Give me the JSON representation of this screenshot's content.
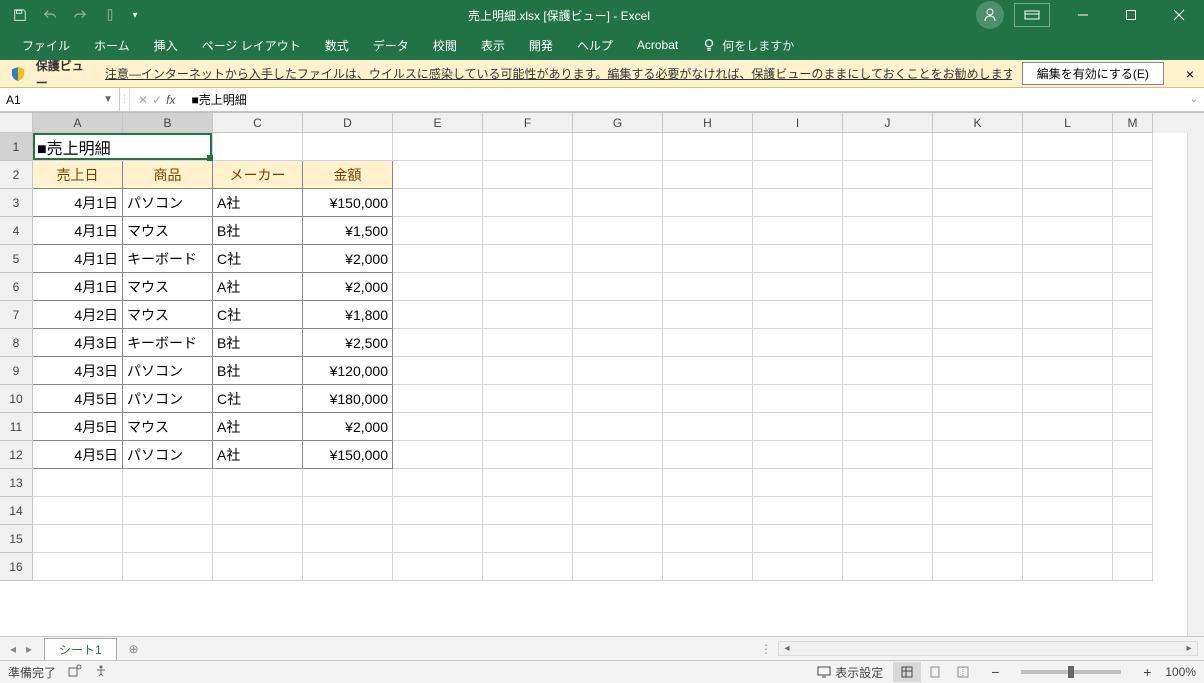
{
  "title": "売上明細.xlsx [保護ビュー] - Excel",
  "ribbon": {
    "tabs": [
      "ファイル",
      "ホーム",
      "挿入",
      "ページ レイアウト",
      "数式",
      "データ",
      "校閲",
      "表示",
      "開発",
      "ヘルプ",
      "Acrobat"
    ],
    "tell_me": "何をしますか"
  },
  "protected_view": {
    "label": "保護ビュー",
    "message": "注意—インターネットから入手したファイルは、ウイルスに感染している可能性があります。編集する必要がなければ、保護ビューのままにしておくことをお勧めします。",
    "button": "編集を有効にする(E)"
  },
  "formula_bar": {
    "name_box": "A1",
    "fx": "fx",
    "content": "■売上明細"
  },
  "columns": [
    "A",
    "B",
    "C",
    "D",
    "E",
    "F",
    "G",
    "H",
    "I",
    "J",
    "K",
    "L",
    "M"
  ],
  "row_numbers": [
    "1",
    "2",
    "3",
    "4",
    "5",
    "6",
    "7",
    "8",
    "9",
    "10",
    "11",
    "12",
    "13",
    "14",
    "15",
    "16"
  ],
  "table": {
    "title": "■売上明細",
    "headers": [
      "売上日",
      "商品",
      "メーカー",
      "金額"
    ],
    "rows": [
      {
        "date": "4月1日",
        "product": "パソコン",
        "maker": "A社",
        "amount": "¥150,000"
      },
      {
        "date": "4月1日",
        "product": "マウス",
        "maker": "B社",
        "amount": "¥1,500"
      },
      {
        "date": "4月1日",
        "product": "キーボード",
        "maker": "C社",
        "amount": "¥2,000"
      },
      {
        "date": "4月1日",
        "product": "マウス",
        "maker": "A社",
        "amount": "¥2,000"
      },
      {
        "date": "4月2日",
        "product": "マウス",
        "maker": "C社",
        "amount": "¥1,800"
      },
      {
        "date": "4月3日",
        "product": "キーボード",
        "maker": "B社",
        "amount": "¥2,500"
      },
      {
        "date": "4月3日",
        "product": "パソコン",
        "maker": "B社",
        "amount": "¥120,000"
      },
      {
        "date": "4月5日",
        "product": "パソコン",
        "maker": "C社",
        "amount": "¥180,000"
      },
      {
        "date": "4月5日",
        "product": "マウス",
        "maker": "A社",
        "amount": "¥2,000"
      },
      {
        "date": "4月5日",
        "product": "パソコン",
        "maker": "A社",
        "amount": "¥150,000"
      }
    ]
  },
  "sheet_tabs": {
    "active": "シート1"
  },
  "status": {
    "ready": "準備完了",
    "display_settings": "表示設定",
    "zoom": "100%"
  }
}
